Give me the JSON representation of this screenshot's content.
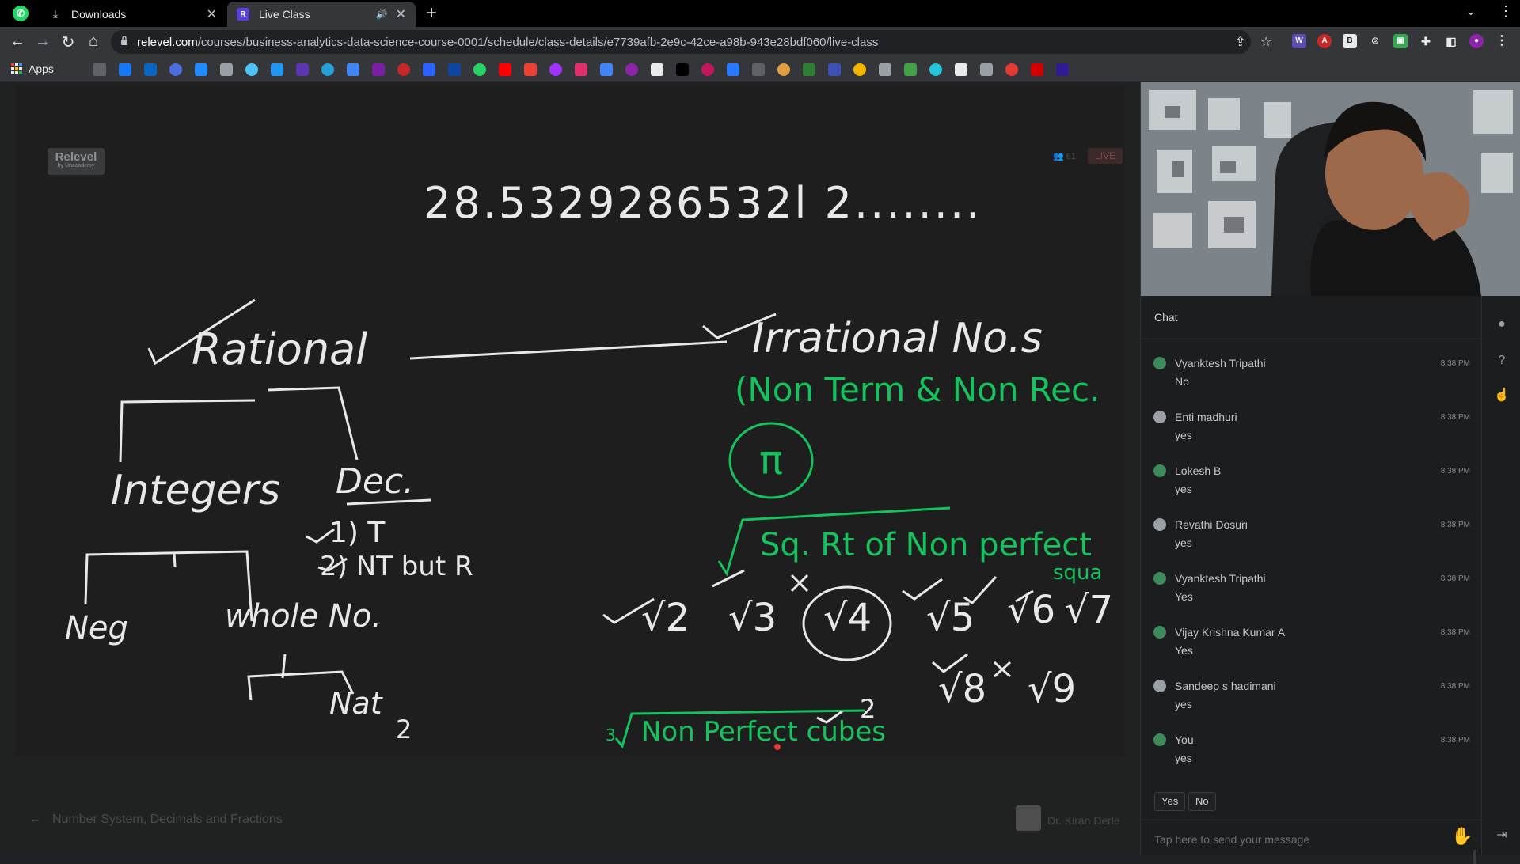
{
  "browser": {
    "tabs": [
      {
        "label": "Downloads",
        "icon": "download-icon",
        "active": false
      },
      {
        "label": "Live Class",
        "icon": "relevel-favicon",
        "favicon_letter": "R",
        "active": true,
        "audio": true
      }
    ],
    "url_domain": "relevel.com",
    "url_path": "/courses/business-analytics-data-science-course-0001/schedule/class-details/e7739afb-2e9c-42ce-a98b-943e28bdf060/live-class",
    "bookmarks_apps_label": "Apps"
  },
  "board": {
    "brand_name": "Relevel",
    "brand_sub": "by Unacademy",
    "viewer_count": "61",
    "live_label": "LIVE",
    "lecture_title": "Number System, Decimals and Fractions",
    "teacher_name": "Dr. Kiran Derle"
  },
  "whiteboard": {
    "number": "28.5329286532l 2........",
    "rational": "Rational",
    "irrational": "Irrational No.s",
    "integers": "Integers",
    "dec": "Dec.",
    "t1": "1) T",
    "t2": "2) NT but R",
    "neg": "Neg",
    "whole": "whole No.",
    "nat": "Nat",
    "two": "2",
    "non_term": "(Non Term & Non Rec.",
    "pi": "π",
    "sq_rt": "Sq. Rt of Non perfect",
    "squa": "squa",
    "roots": [
      "√2",
      "√3",
      "√4",
      "√5",
      "√6",
      "√7",
      "√8",
      "√9"
    ],
    "cube_root_index": "3",
    "non_perfect_cubes": "Non Perfect cubes",
    "cube_two": "2"
  },
  "chat": {
    "title": "Chat",
    "messages": [
      {
        "author": "Vyanktesh Tripathi",
        "time": "8:38 PM",
        "text": "No",
        "avatar": "photo"
      },
      {
        "author": "Enti madhuri",
        "time": "8:38 PM",
        "text": "yes",
        "avatar": "default"
      },
      {
        "author": "Lokesh B",
        "time": "8:38 PM",
        "text": "yes",
        "avatar": "photo"
      },
      {
        "author": "Revathi Dosuri",
        "time": "8:38 PM",
        "text": "yes",
        "avatar": "default"
      },
      {
        "author": "Vyanktesh Tripathi",
        "time": "8:38 PM",
        "text": "Yes",
        "avatar": "photo"
      },
      {
        "author": "Vijay Krishna Kumar A",
        "time": "8:38 PM",
        "text": "Yes",
        "avatar": "photo"
      },
      {
        "author": "Sandeep s hadimani",
        "time": "8:38 PM",
        "text": "yes",
        "avatar": "default"
      },
      {
        "author": "You",
        "time": "8:38 PM",
        "text": "yes",
        "avatar": "photo"
      }
    ],
    "quick_replies": [
      "Yes",
      "No"
    ],
    "input_placeholder": "Tap here to send your message"
  }
}
